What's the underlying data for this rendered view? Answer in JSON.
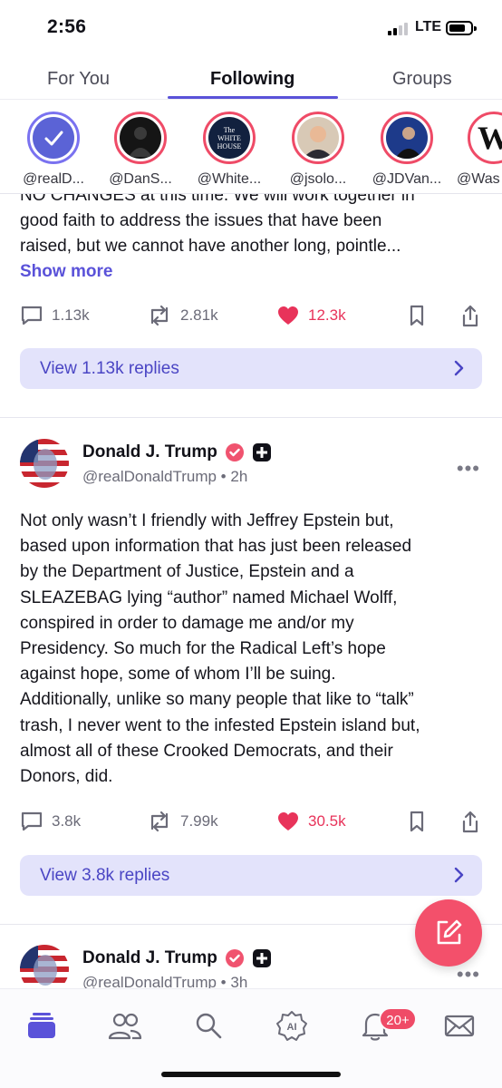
{
  "status_bar": {
    "time": "2:56",
    "network": "LTE"
  },
  "tabs": [
    {
      "label": "For You"
    },
    {
      "label": "Following",
      "active": true
    },
    {
      "label": "Groups"
    }
  ],
  "stories": [
    {
      "label": "@realD..."
    },
    {
      "label": "@DanS..."
    },
    {
      "label": "@White...",
      "avatar_text": "The WHITE HOUSE"
    },
    {
      "label": "@jsolo..."
    },
    {
      "label": "@JDVan..."
    },
    {
      "label": "@Was"
    }
  ],
  "post1": {
    "text_lines": [
      "NO CHANGES at this time. We will work together in",
      "good faith to address the issues that have been",
      "raised, but we cannot have another long, pointle..."
    ],
    "show_more": "Show more",
    "replies": "1.13k",
    "reposts": "2.81k",
    "likes": "12.3k",
    "view_replies": "View 1.13k replies"
  },
  "post2": {
    "author": "Donald J. Trump",
    "handle": "@realDonaldTrump • 2h",
    "text_lines": [
      "Not only wasn’t I friendly with Jeffrey Epstein but,",
      "based upon information that has just been released",
      "by the Department of Justice, Epstein and a",
      "SLEAZEBAG lying “author” named Michael Wolff,",
      "conspired in order to damage me and/or my",
      "Presidency. So much for the Radical Left’s hope",
      "against hope, some of whom I’ll be suing.",
      "Additionally, unlike so many people that like to “talk”",
      "trash, I never went to the infested Epstein island but,",
      "almost all of these Crooked Democrats, and their",
      "Donors, did."
    ],
    "replies": "3.8k",
    "reposts": "7.99k",
    "likes": "30.5k",
    "view_replies": "View 3.8k replies"
  },
  "post3": {
    "author": "Donald J. Trump",
    "handle": "@realDonaldTrump • 3h"
  },
  "notifications_badge": "20+",
  "nav_items": [
    "feed-icon",
    "people-icon",
    "search-icon",
    "ai-icon",
    "bell-icon",
    "mail-icon"
  ],
  "colors": {
    "accent": "#5a52d9",
    "like": "#e8335a",
    "story_ring": "#ef4b67",
    "fab": "#f3506b"
  }
}
